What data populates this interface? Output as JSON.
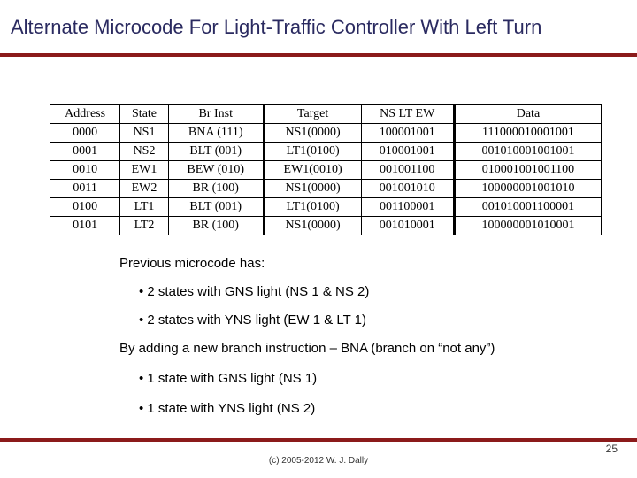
{
  "title": "Alternate Microcode For Light-Traffic Controller With Left Turn",
  "table": {
    "headers": [
      "Address",
      "State",
      "Br Inst",
      "Target",
      "NS LT EW",
      "Data"
    ],
    "rows": [
      [
        "0000",
        "NS1",
        "BNA (111)",
        "NS1(0000)",
        "100001001",
        "111000010001001"
      ],
      [
        "0001",
        "NS2",
        "BLT (001)",
        "LT1(0100)",
        "010001001",
        "001010001001001"
      ],
      [
        "0010",
        "EW1",
        "BEW (010)",
        "EW1(0010)",
        "001001100",
        "010001001001100"
      ],
      [
        "0011",
        "EW2",
        "BR (100)",
        "NS1(0000)",
        "001001010",
        "100000001001010"
      ],
      [
        "0100",
        "LT1",
        "BLT (001)",
        "LT1(0100)",
        "001100001",
        "001010001100001"
      ],
      [
        "0101",
        "LT2",
        "BR (100)",
        "NS1(0000)",
        "001010001",
        "100000001010001"
      ]
    ]
  },
  "body": {
    "line1": "Previous microcode has:",
    "bullet1a": "2 states with GNS light (NS 1 & NS 2)",
    "bullet1b": "2 states with YNS light (EW 1 & LT 1)",
    "line2": "By adding a new branch instruction – BNA (branch on “not any”)",
    "bullet2a": "1 state with GNS light (NS 1)",
    "bullet2b": "1 state with YNS light (NS 2)"
  },
  "footer": "(c) 2005-2012 W. J. Dally",
  "page": "25"
}
